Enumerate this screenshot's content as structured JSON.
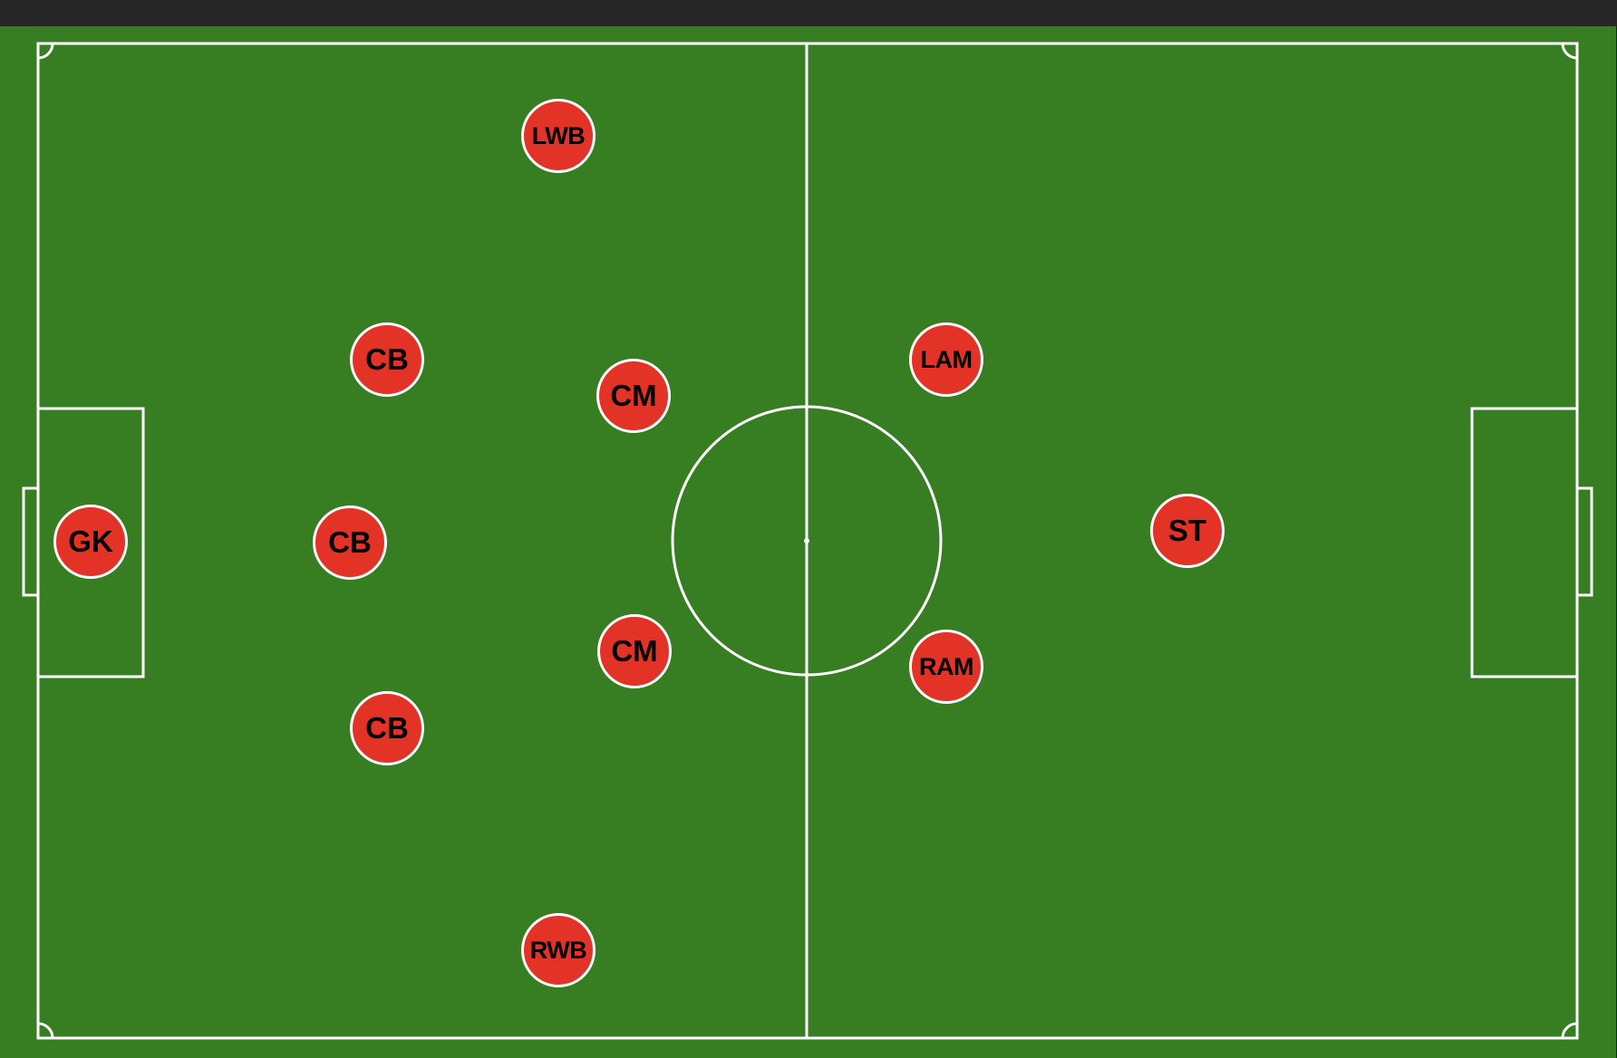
{
  "colors": {
    "pitch": "#377d22",
    "lines": "#ffffff",
    "player_fill": "#e33226",
    "player_text": "#000000",
    "top_bar": "#262626"
  },
  "formation": {
    "players": [
      {
        "id": "gk",
        "label": "GK"
      },
      {
        "id": "cb-left",
        "label": "CB"
      },
      {
        "id": "cb-center",
        "label": "CB"
      },
      {
        "id": "cb-right",
        "label": "CB"
      },
      {
        "id": "lwb",
        "label": "LWB"
      },
      {
        "id": "rwb",
        "label": "RWB"
      },
      {
        "id": "cm-left",
        "label": "CM"
      },
      {
        "id": "cm-right",
        "label": "CM"
      },
      {
        "id": "lam",
        "label": "LAM"
      },
      {
        "id": "ram",
        "label": "RAM"
      },
      {
        "id": "st",
        "label": "ST"
      }
    ]
  }
}
